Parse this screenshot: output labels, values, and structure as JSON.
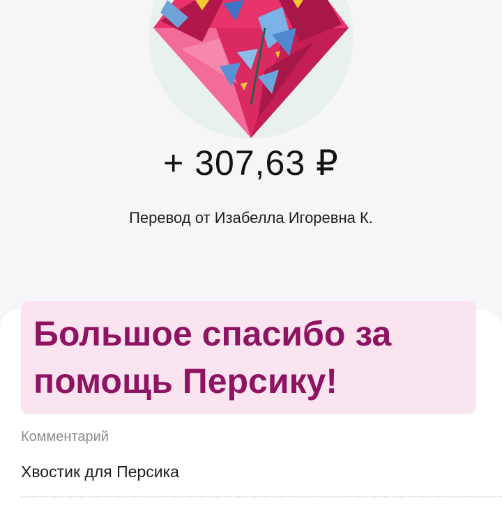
{
  "header": {
    "gift_icon": "gift-diamond-illustration"
  },
  "transfer": {
    "amount": "+ 307,63 ₽",
    "description": "Перевод от Изабелла Игоревна К."
  },
  "message": {
    "line1": "Большое спасибо за",
    "line2": "помощь Персику!"
  },
  "comment": {
    "label": "Комментарий",
    "text": "Хвостик для Персика"
  },
  "colors": {
    "accent": "#8e1461",
    "banner_bg": "#f9e4f0",
    "diamond_pink": "#e8336b",
    "background": "#f6f6f8"
  }
}
